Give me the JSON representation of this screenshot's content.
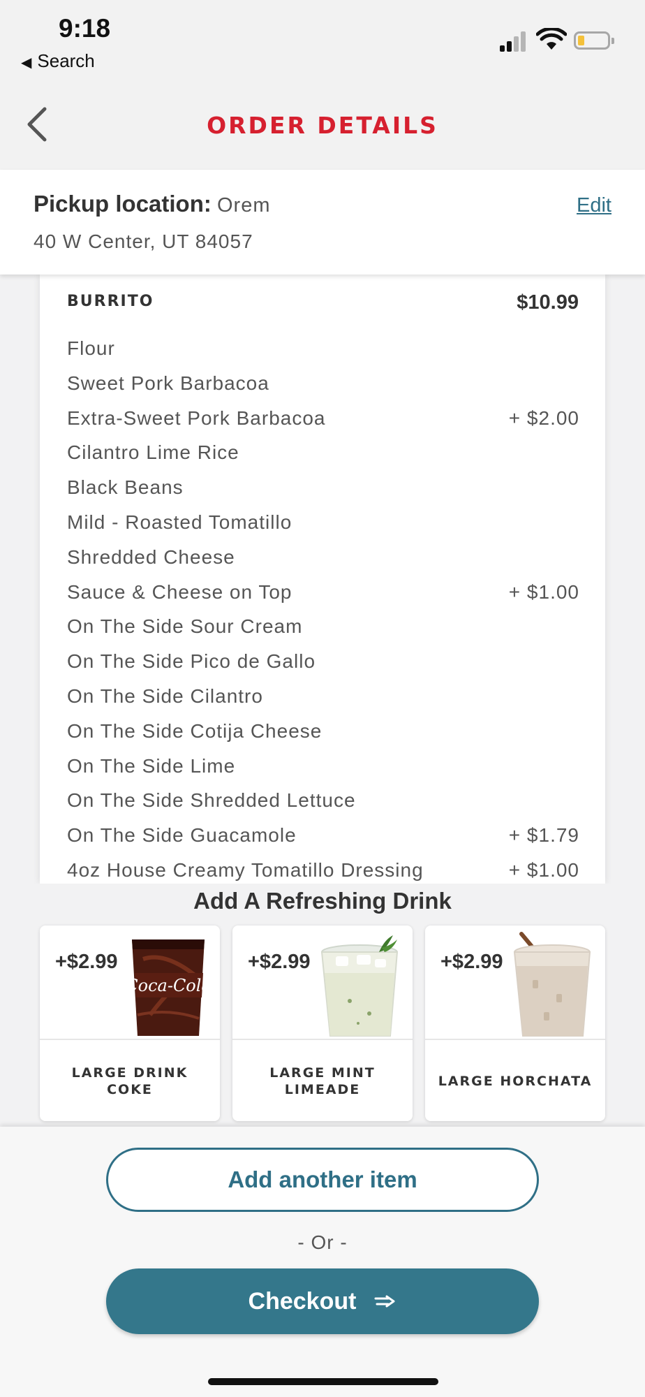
{
  "status_bar": {
    "time": "9:18",
    "back_app_label": "Search"
  },
  "header": {
    "title": "ORDER DETAILS"
  },
  "pickup": {
    "label": "Pickup location:",
    "city": "Orem",
    "address": "40 W Center, UT 84057",
    "edit_label": "Edit"
  },
  "order": {
    "item_name": "BURRITO",
    "item_price": "$10.99",
    "options": [
      {
        "label": "Flour",
        "price": ""
      },
      {
        "label": "Sweet Pork Barbacoa",
        "price": ""
      },
      {
        "label": "Extra-Sweet Pork Barbacoa",
        "price": "+ $2.00"
      },
      {
        "label": "Cilantro Lime Rice",
        "price": ""
      },
      {
        "label": "Black Beans",
        "price": ""
      },
      {
        "label": "Mild - Roasted Tomatillo",
        "price": ""
      },
      {
        "label": "Shredded Cheese",
        "price": ""
      },
      {
        "label": "Sauce & Cheese on Top",
        "price": "+ $1.00"
      },
      {
        "label": "On The Side Sour Cream",
        "price": ""
      },
      {
        "label": "On The Side Pico de Gallo",
        "price": ""
      },
      {
        "label": "On The Side Cilantro",
        "price": ""
      },
      {
        "label": "On The Side Cotija Cheese",
        "price": ""
      },
      {
        "label": "On The Side Lime",
        "price": ""
      },
      {
        "label": "On The Side Shredded Lettuce",
        "price": ""
      },
      {
        "label": "On The Side Guacamole",
        "price": "+ $1.79"
      },
      {
        "label": "4oz House Creamy Tomatillo Dressing",
        "price": "+ $1.00"
      }
    ]
  },
  "drinks": {
    "title": "Add A Refreshing Drink",
    "items": [
      {
        "price": "+$2.99",
        "name": "LARGE DRINK COKE",
        "logo_text": "Coca-Cola"
      },
      {
        "price": "+$2.99",
        "name": "LARGE MINT LIMEADE"
      },
      {
        "price": "+$2.99",
        "name": "LARGE HORCHATA"
      }
    ]
  },
  "actions": {
    "add_another_label": "Add another item",
    "or_label": "- Or -",
    "checkout_label": "Checkout"
  },
  "colors": {
    "brand_red": "#d6202f",
    "accent_teal": "#2f6f86",
    "checkout_bg": "#34778b"
  }
}
